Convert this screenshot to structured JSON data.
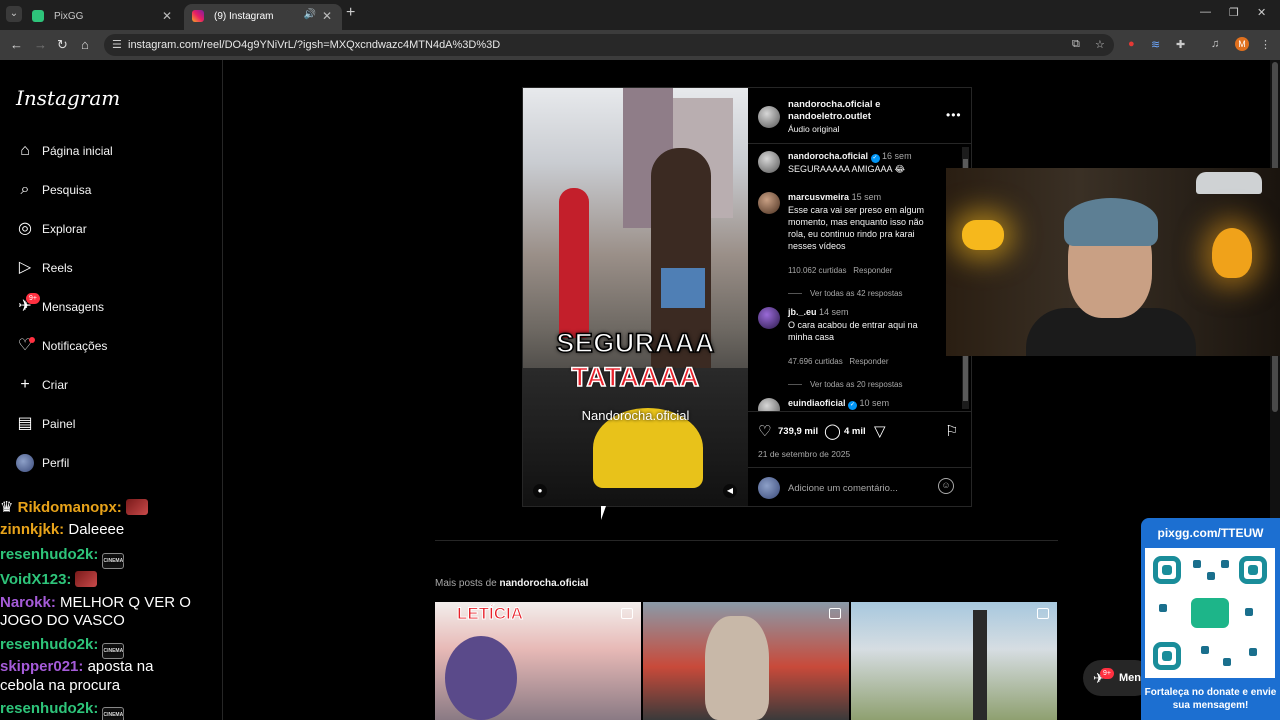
{
  "browser": {
    "tabs": [
      {
        "title": "PixGG",
        "active": false
      },
      {
        "title": "(9) Instagram",
        "active": true
      }
    ],
    "url": "instagram.com/reel/DO4g9YNiVrL/?igsh=MXQxcndwazc4MTN4dA%3D%3D",
    "profile_initial": "M"
  },
  "sidebar": {
    "logo": "Instagram",
    "items": [
      {
        "label": "Página inicial",
        "icon": "home-icon"
      },
      {
        "label": "Pesquisa",
        "icon": "search-icon"
      },
      {
        "label": "Explorar",
        "icon": "compass-icon"
      },
      {
        "label": "Reels",
        "icon": "reels-icon"
      },
      {
        "label": "Mensagens",
        "icon": "messenger-icon",
        "badge": "9+"
      },
      {
        "label": "Notificações",
        "icon": "heart-icon",
        "dot": true
      },
      {
        "label": "Criar",
        "icon": "plus-icon"
      },
      {
        "label": "Painel",
        "icon": "dashboard-icon"
      },
      {
        "label": "Perfil",
        "icon": "avatar"
      }
    ]
  },
  "post": {
    "video": {
      "caption_line1": "SEGURAAA",
      "caption_line2": "TATAAAA",
      "watermark": "Nandorocha.oficial"
    },
    "header": {
      "authors": "nandorocha.oficial e nandoeletro.outlet",
      "audio": "Áudio original"
    },
    "comments": [
      {
        "user": "nandorocha.oficial",
        "verified": true,
        "time": "16 sem",
        "text": "SEGURAAAAA AMIGAAA 😂",
        "likes": "",
        "reply": "",
        "view_replies": ""
      },
      {
        "user": "marcusvmeira",
        "verified": false,
        "time": "15 sem",
        "text": "Esse cara vai ser preso em algum momento, mas enquanto isso não rola, eu continuo rindo pra karai nesses vídeos",
        "likes": "110.062 curtidas",
        "reply": "Responder",
        "view_replies": "Ver todas as 42 respostas"
      },
      {
        "user": "jb._.eu",
        "verified": false,
        "time": "14 sem",
        "text": "O cara acabou de entrar aqui na minha casa",
        "likes": "47.696 curtidas",
        "reply": "Responder",
        "view_replies": "Ver todas as 20 respostas"
      },
      {
        "user": "euindiaoficial",
        "verified": true,
        "time": "10 sem",
        "text": "",
        "likes": "",
        "reply": "",
        "view_replies": ""
      }
    ],
    "likes_count": "739,9 mil",
    "comments_count": "4 mil",
    "date": "21 de setembro de 2025",
    "comment_placeholder": "Adicione um comentário..."
  },
  "more_posts": {
    "prefix": "Mais posts de",
    "user": "nandorocha.oficial",
    "thumbs": [
      {
        "label": "LETÍCIA"
      },
      {
        "label": ""
      },
      {
        "label": ""
      }
    ]
  },
  "messages_pill": {
    "label": "Mensagens",
    "badge": "9+"
  },
  "stream": {
    "qr_url": "pixgg.com/TTEUW",
    "qr_text": "Fortaleça no donate e envie sua mensagem!",
    "chat": [
      {
        "user": "Rikdomanopx:",
        "text": "",
        "color": "#e8a31a",
        "emote": "red"
      },
      {
        "user": "zinnkjkk:",
        "text": "Daleeee",
        "color": "#e8a31a",
        "emote": ""
      },
      {
        "user": "resenhudo2k:",
        "text": "",
        "color": "#2ec47a",
        "emote": "cinema"
      },
      {
        "user": "VoidX123:",
        "text": "",
        "color": "#2ec47a",
        "emote": "red"
      },
      {
        "user": "Narokk:",
        "text": "MELHOR Q VER O",
        "color": "#a55bd8",
        "emote": ""
      },
      {
        "user": "",
        "text": "JOGO DO VASCO",
        "color": "#ffffff",
        "emote": ""
      },
      {
        "user": "resenhudo2k:",
        "text": "",
        "color": "#2ec47a",
        "emote": "cinema"
      },
      {
        "user": "skipper021:",
        "text": "aposta na",
        "color": "#a55bd8",
        "emote": ""
      },
      {
        "user": "",
        "text": "cebola na procura",
        "color": "#ffffff",
        "emote": ""
      },
      {
        "user": "resenhudo2k:",
        "text": "",
        "color": "#2ec47a",
        "emote": "cinema"
      }
    ]
  }
}
